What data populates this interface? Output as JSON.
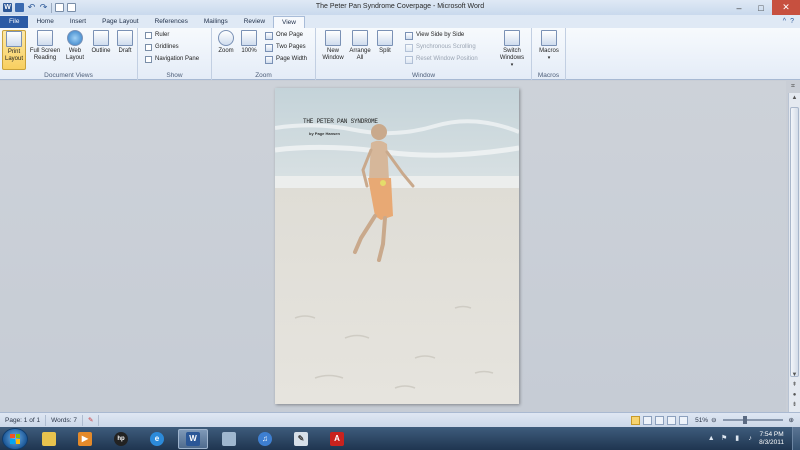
{
  "window": {
    "title": "The Peter Pan Syndrome Coverpage - Microsoft Word"
  },
  "ribbon_tabs": [
    "File",
    "Home",
    "Insert",
    "Page Layout",
    "References",
    "Mailings",
    "Review",
    "View"
  ],
  "active_tab": "View",
  "ribbon": {
    "document_views": {
      "label": "Document Views",
      "print_layout": "Print Layout",
      "full_screen_reading": "Full Screen Reading",
      "web_layout": "Web Layout",
      "outline": "Outline",
      "draft": "Draft"
    },
    "show": {
      "label": "Show",
      "ruler": "Ruler",
      "gridlines": "Gridlines",
      "navigation_pane": "Navigation Pane"
    },
    "zoom": {
      "label": "Zoom",
      "zoom": "Zoom",
      "hundred": "100%",
      "one_page": "One Page",
      "two_pages": "Two Pages",
      "page_width": "Page Width"
    },
    "window": {
      "label": "Window",
      "new_window": "New Window",
      "arrange_all": "Arrange All",
      "split": "Split",
      "view_side_by_side": "View Side by Side",
      "synchronous_scrolling": "Synchronous Scrolling",
      "reset_window_position": "Reset Window Position",
      "switch_windows": "Switch Windows"
    },
    "macros": {
      "label": "Macros",
      "macros": "Macros"
    }
  },
  "document": {
    "cover_title": "THE PETER PAN SYNDROME",
    "cover_author": "by Page Hansen"
  },
  "statusbar": {
    "page": "Page: 1 of 1",
    "words": "Words: 7",
    "zoom_percent": "51%",
    "zoom_level": 0.51
  },
  "taskbar": {
    "apps": [
      "windows-explorer",
      "media-player",
      "hp",
      "internet-explorer",
      "microsoft-word",
      "network",
      "itunes",
      "paint",
      "adobe-reader"
    ],
    "time": "7:54 PM",
    "date": "8/3/2011"
  },
  "colors": {
    "file_tab": "#2a5aa5",
    "title_bar": "#dfe9f5",
    "close_button": "#c7503f",
    "taskbar": "#1f3550"
  }
}
